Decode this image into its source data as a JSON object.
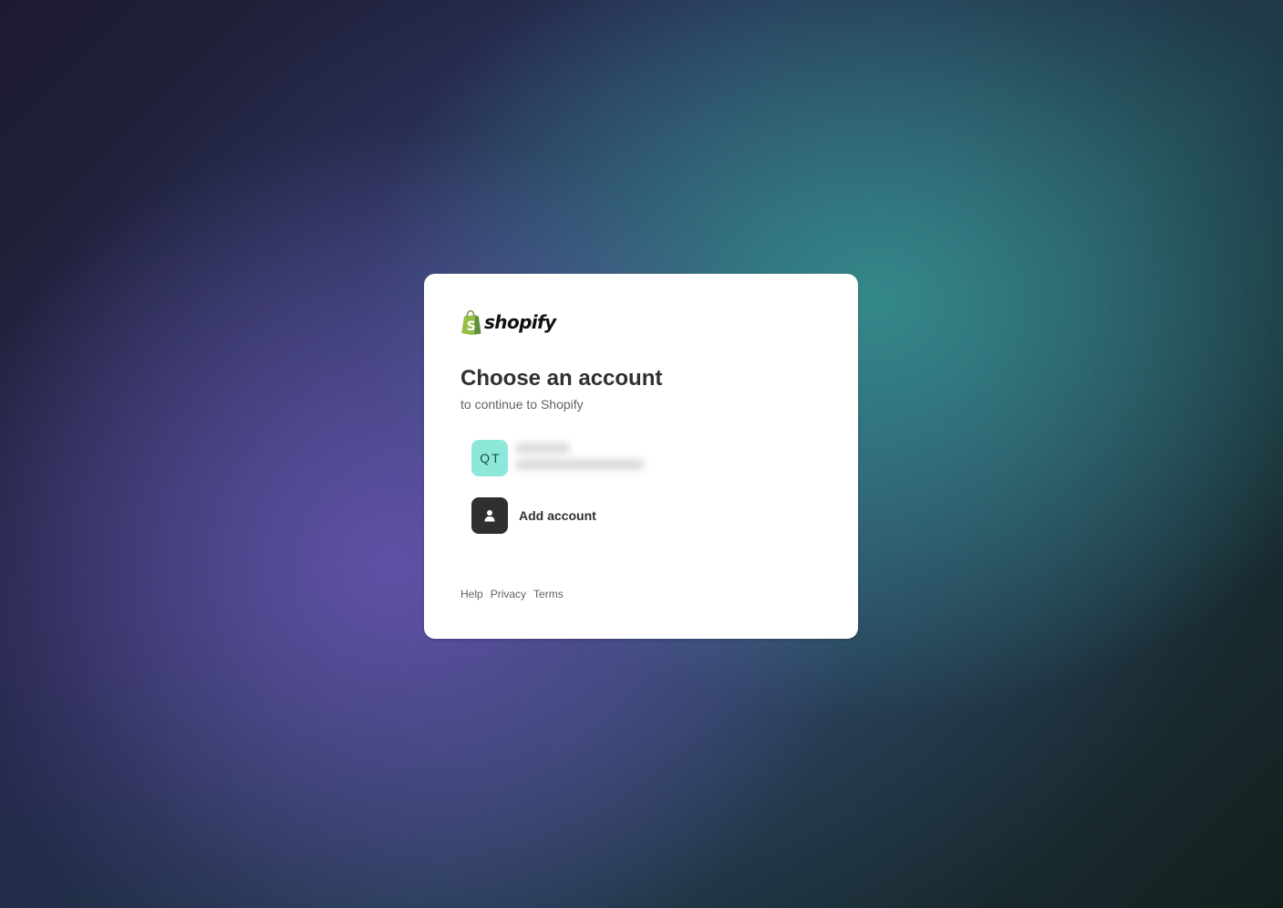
{
  "brand": {
    "wordmark": "shopify",
    "bag_color": "#95bf47",
    "icon": "shopify-bag-icon"
  },
  "heading": {
    "title": "Choose an account",
    "subtitle": "to continue to Shopify"
  },
  "accounts": [
    {
      "initials": "QT",
      "avatar_color": "#8de8da",
      "details_blurred": true
    }
  ],
  "add_account": {
    "label": "Add account",
    "icon": "person-icon"
  },
  "footer": {
    "links": [
      "Help",
      "Privacy",
      "Terms"
    ]
  },
  "colors": {
    "card_background": "#ffffff",
    "text_primary": "#303030",
    "text_secondary": "#616161"
  }
}
